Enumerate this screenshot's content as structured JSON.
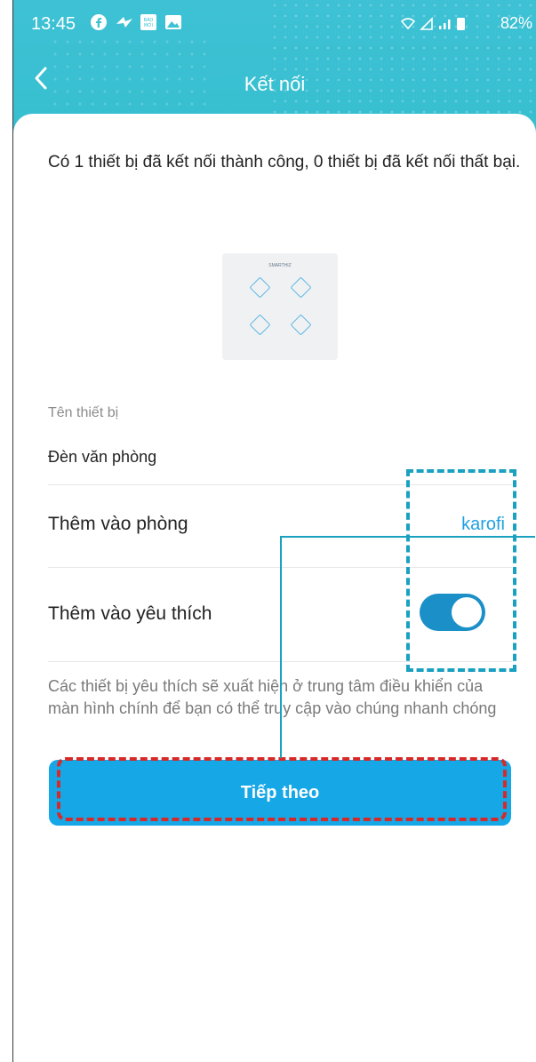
{
  "statusbar": {
    "time": "13:45",
    "battery": "82%",
    "app_icons": [
      "facebook-icon",
      "messenger-icon",
      "baomoi-icon",
      "gallery-icon"
    ]
  },
  "header": {
    "title": "Kết nối",
    "back_icon": "chevron-left-icon"
  },
  "intro_text": "Có 1 thiết bị đã kết nối thành công, 0 thiết bị đã kết nối thất bại.",
  "device_image": {
    "brand": "SMARTHIZ"
  },
  "device_name": {
    "label": "Tên thiết bị",
    "value": "Đèn văn phòng"
  },
  "room_row": {
    "label": "Thêm vào phòng",
    "value": "karofi"
  },
  "favorite_row": {
    "label": "Thêm vào yêu thích",
    "enabled": true
  },
  "note": "Các thiết bị yêu thích sẽ xuất hiện ở trung tâm điều khiển của màn hình chính để bạn có thể truy cập vào chúng nhanh chóng",
  "next_button": {
    "label": "Tiếp theo"
  },
  "colors": {
    "header": "#3ec1d4",
    "accent": "#15a7e6",
    "link": "#1fa1e0",
    "annotation_blue": "#1aa0c0",
    "annotation_red": "#d62a2a"
  }
}
